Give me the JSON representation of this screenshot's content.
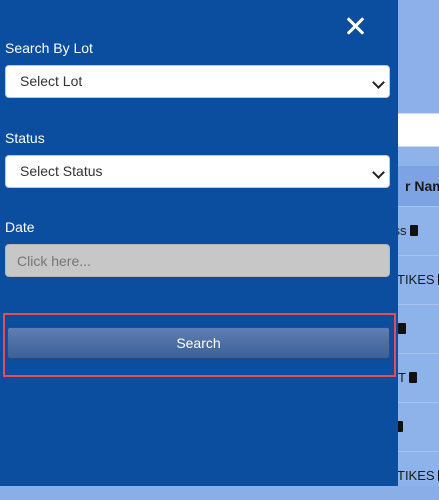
{
  "drawer": {
    "lot_label": "Search By Lot",
    "lot_select_value": "Select Lot",
    "status_label": "Status",
    "status_select_value": "Select Status",
    "date_label": "Date",
    "date_placeholder": "Click here...",
    "search_button": "Search"
  },
  "background": {
    "header_fragment": "r Nam",
    "rows": [
      "ress",
      "TIKES",
      "",
      "T",
      "",
      "TIKES"
    ]
  }
}
